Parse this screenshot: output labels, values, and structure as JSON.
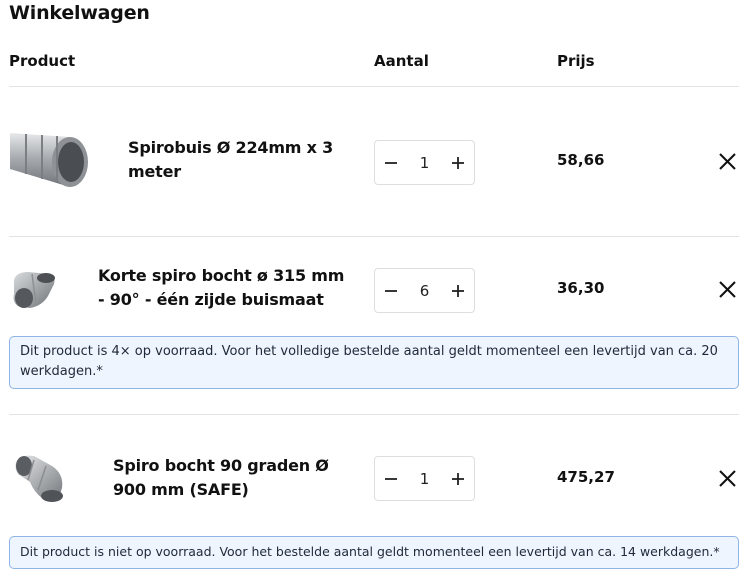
{
  "cart": {
    "title": "Winkelwagen",
    "columns": {
      "product": "Product",
      "quantity": "Aantal",
      "price": "Prijs"
    },
    "items": [
      {
        "name": "Spirobuis Ø 224mm x 3 meter",
        "quantity": "1",
        "price": "58,66",
        "image_icon": "spiral-duct-pipe-image",
        "notice": ""
      },
      {
        "name": "Korte spiro bocht ø 315 mm - 90° - één zijde buismaat",
        "quantity": "6",
        "price": "36,30",
        "image_icon": "short-spiral-bend-image",
        "notice": "Dit product is 4× op voorraad. Voor het volledige bestelde aantal geldt momenteel een levertijd van ca. 20 werkdagen.*"
      },
      {
        "name": "Spiro bocht 90 graden Ø 900 mm (SAFE)",
        "quantity": "1",
        "price": "475,27",
        "image_icon": "spiral-bend-90-image",
        "notice": "Dit product is niet op voorraad. Voor het bestelde aantal geldt momenteel een levertijd van ca. 14 werkdagen.*"
      }
    ]
  },
  "icons": {
    "decrease": "minus-icon",
    "increase": "plus-icon",
    "remove": "close-icon"
  },
  "colors": {
    "notice_border": "#8fb4e6",
    "notice_background": "#eef5ff",
    "divider": "#e3e3e3"
  }
}
